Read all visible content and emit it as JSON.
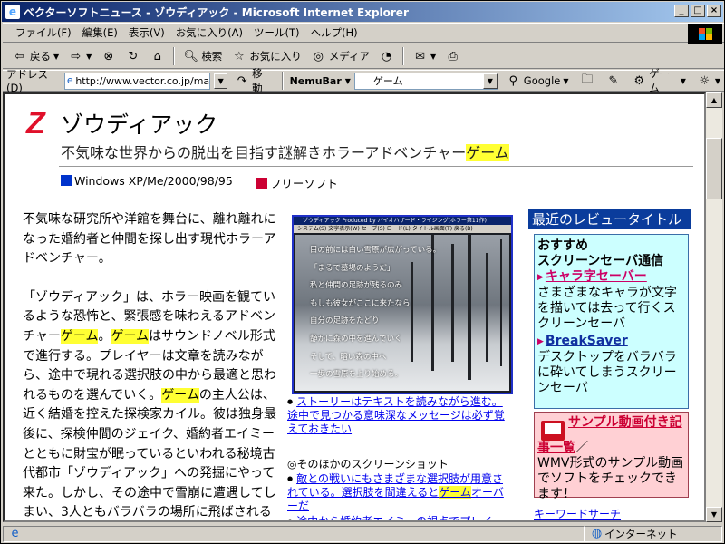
{
  "window": {
    "title": "ベクターソフトニュース - ゾウディアック - Microsoft Internet Explorer"
  },
  "menu": [
    "ファイル(F)",
    "編集(E)",
    "表示(V)",
    "お気に入り(A)",
    "ツール(T)",
    "ヘルプ(H)"
  ],
  "toolbar": {
    "back": "戻る",
    "search": "検索",
    "favorites": "お気に入り",
    "media": "メディア"
  },
  "addressbar": {
    "label": "アドレス(D)",
    "url": "http://www.vector.co.jp/ma",
    "go": "移動",
    "nemubar": "NemuBar",
    "search_value": "ゲーム",
    "google": "Google",
    "game_btn": "ゲーム"
  },
  "page": {
    "title": "ゾウディアック",
    "subtitle_pre": "不気味な世界からの脱出を目指す謎解きホラーアドベンチャー",
    "subtitle_hl": "ゲーム",
    "platform": "Windows XP/Me/2000/98/95",
    "license": "フリーソフト",
    "p1": "不気味な研究所や洋館を舞台に、離れ離れになった婚約者と仲間を探し出す現代ホラーアドベンチャー。",
    "p2_a": "「ゾウディアック」は、ホラー映画を観ているような恐怖と、緊張感を味わえるアドベンチャー",
    "p2_hl1": "ゲーム",
    "p2_b": "。",
    "p2_hl2": "ゲーム",
    "p2_c": "はサウンドノベル形式で進行する。プレイヤーは文章を読みながら、途中で現れる選択肢の中から最適と思われるものを選んでいく。",
    "p2_hl3": "ゲーム",
    "p2_d": "の主人公は、近く結婚を控えた探検家カイル。彼は独身最後に、探検仲間のジェイク、婚約者エイミーとともに財宝が眠っているといわれる秘境古代都市「ゾウディアック」への発掘にやって来た。しかし、その途中で雪崩に遭遇してしまい、3人ともバラバラの場所に飛ばされるというアクシ"
  },
  "screenshot": {
    "title": "ゾウディアック  Produced by バイオハザード・ライジング(ホラー第11作)",
    "menu": "システム(S)  文字表示(W)  セーブ(S)  ロード(L)  タイトル画面(T)  戻る(B)",
    "lines": [
      "目の前には白い雪原が広がっている。",
      "「まるで墓場のようだ」",
      "私と仲間の足跡が残るのみ",
      "もしも彼女がここに来たなら",
      "自分の足跡をたどり",
      "静かに森の中を進んでいく",
      "そして、暗い森の中へ",
      "一歩の雪原を上り始める。"
    ]
  },
  "caption": "ストーリーはテキストを読みながら進む。途中で見つかる意味深なメッセージは必ず覚えておきたい",
  "other": {
    "heading": "◎そのほかのスクリーンショット",
    "link1_a": "敵との戦いにもさまざまな選択肢が用意されている。選択肢を間違えると",
    "link1_hl": "ゲーム",
    "link1_b": "オーバーだ",
    "link2": "途中から婚約者エイミーの視点でプレイ"
  },
  "sidebar": {
    "heading": "最近のレビュータイトル",
    "reco_heading": "おすすめ\nスクリーンセーバ通信",
    "item1": "キャラ字セーバー",
    "item1_desc": "さまざまなキャラが文字を描いては去って行くスクリーンセーバ",
    "item2": "BreakSaver",
    "item2_desc": "デスクトップをバラバラに砕いてしまうスクリーンセーバ",
    "sample_link": "サンプル動画付き記事一覧",
    "sample_slash": "／",
    "sample_desc": "WMV形式のサンプル動画でソフトをチェックできます！",
    "more": "キーワードサーチ"
  },
  "status": {
    "zone": "インターネット"
  },
  "colors": {
    "title_gradient_start": "#0a246a",
    "highlight": "#ffff33",
    "platform_windows": "#0033cc",
    "platform_free": "#cc0033",
    "side_heading_bg": "#0a3c9c",
    "reco_bg": "#ccffff",
    "sample_bg": "#ffd0d4"
  }
}
